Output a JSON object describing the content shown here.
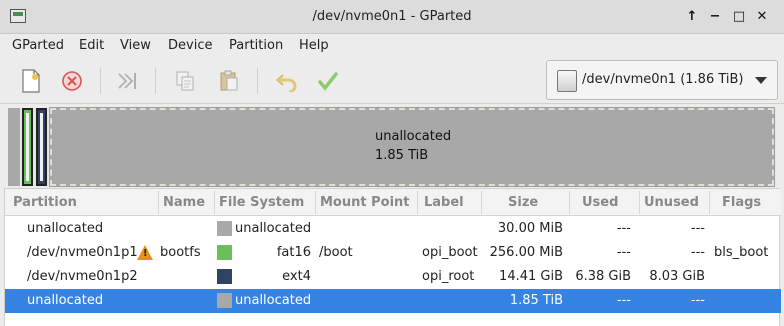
{
  "window": {
    "title": "/dev/nvme0n1 - GParted",
    "controls": {
      "up": "↑",
      "minimize": "−",
      "maximize": "□",
      "close": "✕"
    }
  },
  "menu": [
    "GParted",
    "Edit",
    "View",
    "Device",
    "Partition",
    "Help"
  ],
  "toolbar": {
    "buttons": [
      "new-icon",
      "delete-icon",
      "resize-move-icon",
      "copy-icon",
      "paste-icon",
      "undo-icon",
      "apply-icon"
    ]
  },
  "device": {
    "label": "/dev/nvme0n1 (1.86 TiB)"
  },
  "diskmap": {
    "unallocated_label": "unallocated",
    "unallocated_size": "1.85 TiB",
    "colors": {
      "unallocated": "#a8a8a8",
      "fat16": "#6bbf5a",
      "ext4": "#2f4463"
    }
  },
  "table": {
    "headers": [
      "Partition",
      "Name",
      "File System",
      "Mount Point",
      "Label",
      "Size",
      "Used",
      "Unused",
      "Flags"
    ],
    "rows": [
      {
        "partition": "unallocated",
        "name": "",
        "fs": "unallocated",
        "fs_color": "#a8a8a8",
        "mount": "",
        "label": "",
        "size": "30.00 MiB",
        "used": "---",
        "unused": "---",
        "flags": "",
        "warning": false,
        "selected": false
      },
      {
        "partition": "/dev/nvme0n1p1",
        "name": "bootfs",
        "fs": "fat16",
        "fs_color": "#6bbf5a",
        "mount": "/boot",
        "label": "opi_boot",
        "size": "256.00 MiB",
        "used": "---",
        "unused": "---",
        "flags": "bls_boot",
        "warning": true,
        "selected": false
      },
      {
        "partition": "/dev/nvme0n1p2",
        "name": "",
        "fs": "ext4",
        "fs_color": "#2f4463",
        "mount": "",
        "label": "opi_root",
        "size": "14.41 GiB",
        "used": "6.38 GiB",
        "unused": "8.03 GiB",
        "flags": "",
        "warning": false,
        "selected": false
      },
      {
        "partition": "unallocated",
        "name": "",
        "fs": "unallocated",
        "fs_color": "#a8a8a8",
        "mount": "",
        "label": "",
        "size": "1.85 TiB",
        "used": "---",
        "unused": "---",
        "flags": "",
        "warning": false,
        "selected": true
      }
    ]
  }
}
